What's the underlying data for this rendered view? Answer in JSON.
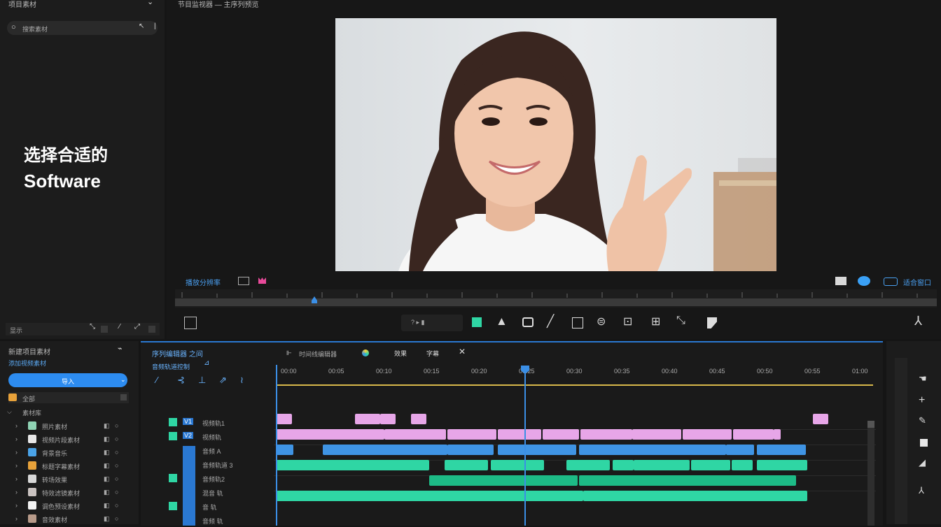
{
  "left_panel": {
    "title": "项目素材",
    "search_placeholder": "搜索素材",
    "bottom_label": "显示",
    "hero_line1": "选择合适的",
    "hero_line2": "Software"
  },
  "preview": {
    "title": "节目监视器 — 主序列预览",
    "left_label": "播放分辨率",
    "right_label": "适合窗口"
  },
  "toolbar": {
    "timecode": "? ▸ ▮"
  },
  "project": {
    "title": "新建项目素材",
    "subtitle": "添加视频素材",
    "import_button": "导入",
    "dropdown": "全部",
    "folder_label": "素材库",
    "items": [
      {
        "label": "照片素材",
        "color": "#8fd3b4"
      },
      {
        "label": "视频片段素材",
        "color": "#e8e8e8"
      },
      {
        "label": "背景音乐",
        "color": "#4aa3e8"
      },
      {
        "label": "标题字幕素材",
        "color": "#e8a23a"
      },
      {
        "label": "转场效果",
        "color": "#d8d8d8"
      },
      {
        "label": "特效滤镜素材",
        "color": "#c9c2c0"
      },
      {
        "label": "调色预设素材",
        "color": "#f2f2f2"
      },
      {
        "label": "音效素材",
        "color": "#b89b8a"
      }
    ]
  },
  "timeline": {
    "title": "序列编辑器 之间",
    "subtitle": "音频轨道控制",
    "tabs": [
      "时间线编辑器",
      "效果",
      "字幕"
    ],
    "ruler_labels": [
      "00:00",
      "00:05",
      "00:10",
      "00:15",
      "00:20",
      "00:25",
      "00:30",
      "00:35",
      "00:40",
      "00:45",
      "00:50",
      "00:55",
      "01:00"
    ],
    "tracks": [
      {
        "name": "视频轨1",
        "badge": "V1"
      },
      {
        "name": "视频轨",
        "badge": "V2"
      },
      {
        "name": "音频 A",
        "badge": ""
      },
      {
        "name": "音频轨道 3",
        "badge": ""
      },
      {
        "name": "音频轨2",
        "badge": ""
      },
      {
        "name": "混音 轨",
        "badge": ""
      },
      {
        "name": "音 轨",
        "badge": ""
      },
      {
        "name": "音频 轨",
        "badge": ""
      }
    ]
  },
  "colors": {
    "accent": "#2a78d2",
    "clip_pink": "#e7a6e8",
    "clip_blue": "#3f94e4",
    "clip_green": "#2fd6a4",
    "playhead": "#3b8fe6"
  }
}
